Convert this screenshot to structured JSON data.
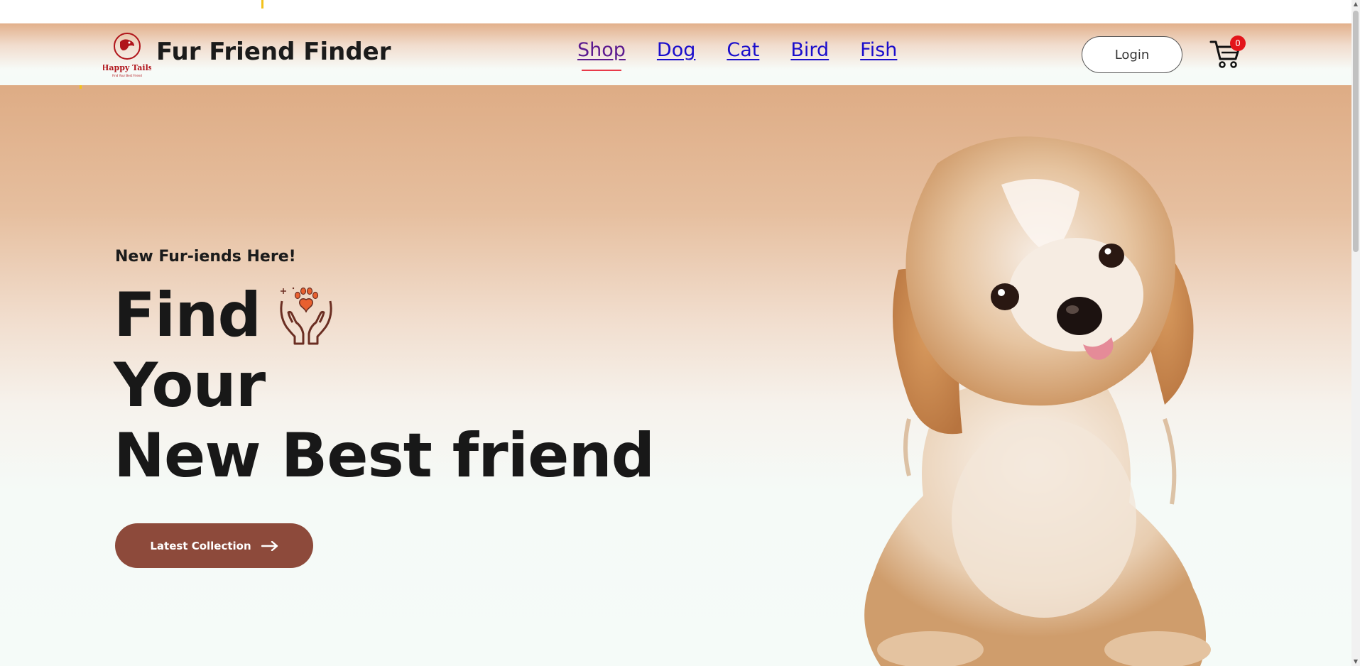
{
  "header": {
    "logo_text": "Happy Tails",
    "logo_subtext": "Find Your Best Friend",
    "brand_title": "Fur Friend Finder",
    "nav": [
      {
        "label": "Shop",
        "active": true
      },
      {
        "label": "Dog",
        "active": false
      },
      {
        "label": "Cat",
        "active": false
      },
      {
        "label": "Bird",
        "active": false
      },
      {
        "label": "Fish",
        "active": false
      }
    ],
    "login_label": "Login",
    "cart_count": "0"
  },
  "hero": {
    "tagline": "New Fur-iends Here!",
    "headline_line1": "Find",
    "headline_line2": "Your",
    "headline_line3": "New Best friend",
    "cta_label": "Latest Collection",
    "cta_icon": "arrow-right-icon"
  },
  "colors": {
    "brand_dark": "#8d4a3b",
    "nav_link": "#1a0dcc",
    "nav_visited": "#5c1a8f",
    "active_underline": "#e83a4a",
    "badge": "#e3141a",
    "hero_top": "#deac85",
    "hero_bottom": "#f5fbf8",
    "logo_red": "#b0141a"
  }
}
